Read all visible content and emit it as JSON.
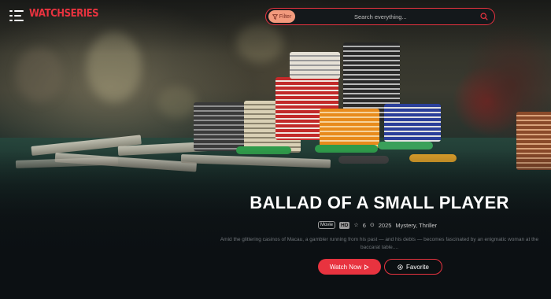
{
  "header": {
    "logo_text": "WATCHSERIES",
    "menu_icon": "menu-icon",
    "filter_label": "Filter",
    "filter_icon": "filter-icon",
    "search_placeholder": "Search everything...",
    "search_icon": "search-icon"
  },
  "featured": {
    "title": "BALLAD OF A SMALL PLAYER",
    "type_badge": "Movie",
    "quality_badge": "HD",
    "rating": "6",
    "year": "2025",
    "genres": "Mystery, Thriller",
    "description": "Amid the glittering casinos of Macau, a gambler running from his past — and his debts — becomes fascinated by an enigmatic woman at the baccarat table....",
    "watch_label": "Watch Now",
    "favorite_label": "Favorite"
  },
  "colors": {
    "accent": "#e8333f",
    "filter_bg": "#f29a7d",
    "background": "#0c1013"
  }
}
